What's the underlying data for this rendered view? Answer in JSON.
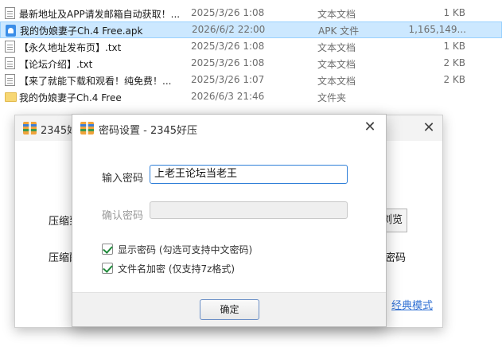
{
  "files": [
    {
      "name": "最新地址及APP请发邮箱自动获取！...",
      "date": "2025/3/26 1:08",
      "type": "文本文档",
      "size": "1 KB",
      "icon": "text-file-icon",
      "selected": false
    },
    {
      "name": "我的伪娘妻子Ch.4 Free.apk",
      "date": "2026/6/2 22:00",
      "type": "APK 文件",
      "size": "1,165,149...",
      "icon": "apk-file-icon",
      "selected": true
    },
    {
      "name": "【永久地址发布页】.txt",
      "date": "2025/3/26 1:08",
      "type": "文本文档",
      "size": "1 KB",
      "icon": "text-file-icon",
      "selected": false
    },
    {
      "name": "【论坛介绍】.txt",
      "date": "2025/3/26 1:08",
      "type": "文本文档",
      "size": "2 KB",
      "icon": "text-file-icon",
      "selected": false
    },
    {
      "name": "【来了就能下载和观看！纯免费！...",
      "date": "2025/3/26 1:07",
      "type": "文本文档",
      "size": "2 KB",
      "icon": "text-file-icon",
      "selected": false
    },
    {
      "name": "我的伪娘妻子Ch.4 Free",
      "date": "2026/6/3 21:46",
      "type": "文件夹",
      "size": "",
      "icon": "folder-icon",
      "selected": false
    }
  ],
  "main_window": {
    "title": "2345好",
    "close_glyph": "✕",
    "label_compress_target": "压缩到",
    "label_compress_method": "压缩配",
    "browse_label": "浏览",
    "password_label": "密码",
    "classic_mode_link": "经典模式"
  },
  "dialog": {
    "title": "密码设置 - 2345好压",
    "close_glyph": "✕",
    "password_label": "输入密码",
    "password_value": "上老王论坛当老王",
    "confirm_label": "确认密码",
    "confirm_value": "",
    "show_password_label": "显示密码 (勾选可支持中文密码)",
    "show_password_checked": true,
    "encrypt_filenames_label": "文件名加密  (仅支持7z格式)",
    "encrypt_filenames_checked": true,
    "ok_label": "确定"
  },
  "colors": {
    "selection_bg": "#cce8ff",
    "selection_border": "#99d1ff",
    "input_focus_border": "#2f7fd8",
    "link": "#2f6fd3",
    "check": "#1f8a3a"
  }
}
